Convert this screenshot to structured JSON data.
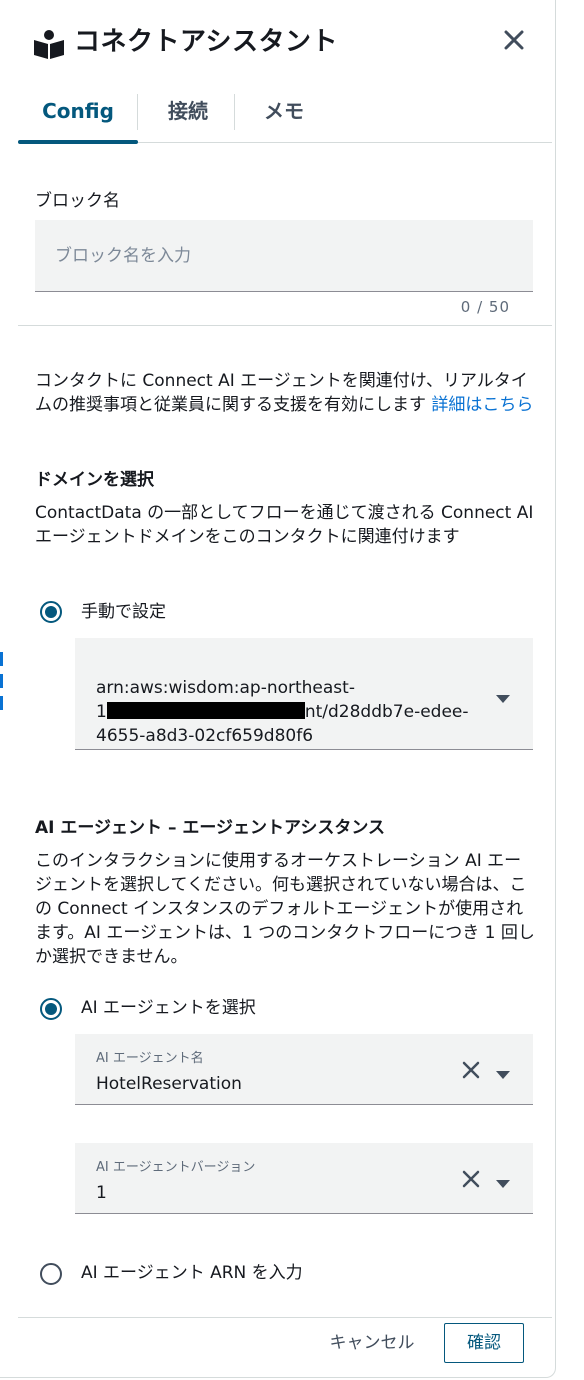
{
  "header": {
    "title": "コネクトアシスタント",
    "icon": "book-person-icon",
    "close_icon": "close-icon"
  },
  "tabs": [
    {
      "label": "Config",
      "active": true
    },
    {
      "label": "接続",
      "active": false
    },
    {
      "label": "メモ",
      "active": false
    }
  ],
  "block_name": {
    "label": "ブロック名",
    "placeholder": "ブロック名を入力",
    "value": "",
    "counter": "0 / 50"
  },
  "description": {
    "text": "コンタクトに Connect AI エージェントを関連付け、リアルタイムの推奨事項と従業員に関する支援を有効にします ",
    "link": "詳細はこちら"
  },
  "domain": {
    "heading": "ドメインを選択",
    "description": "ContactData の一部としてフローを通じて渡される Connect AI エージェントドメインをこのコンタクトに関連付けます",
    "radio_manual_label": "手動で設定",
    "arn_line1": "arn:aws:wisdom:ap-northeast-",
    "arn_line2_prefix": "1",
    "arn_line2_suffix": "nt/d28ddb7e-edee-",
    "arn_line3": "4655-a8d3-02cf659d80f6"
  },
  "ai_agent": {
    "heading": "AI エージェント – エージェントアシスタンス",
    "description": "このインタラクションに使用するオーケストレーション AI エージェントを選択してください。何も選択されていない場合は、この Connect インスタンスのデフォルトエージェントが使用されます。AI エージェントは、1 つのコンタクトフローにつき 1 回しか選択できません。",
    "radio_select_label": "AI エージェントを選択",
    "name_field_label": "AI エージェント名",
    "name_value": "HotelReservation",
    "version_field_label": "AI エージェントバージョン",
    "version_value": "1",
    "radio_arn_label": "AI エージェント ARN を入力"
  },
  "footer": {
    "cancel_label": "キャンセル",
    "confirm_label": "確認"
  },
  "colors": {
    "accent": "#04587d",
    "link": "#0972d3",
    "field_bg": "#f2f3f3",
    "border": "#d5dbdb"
  }
}
